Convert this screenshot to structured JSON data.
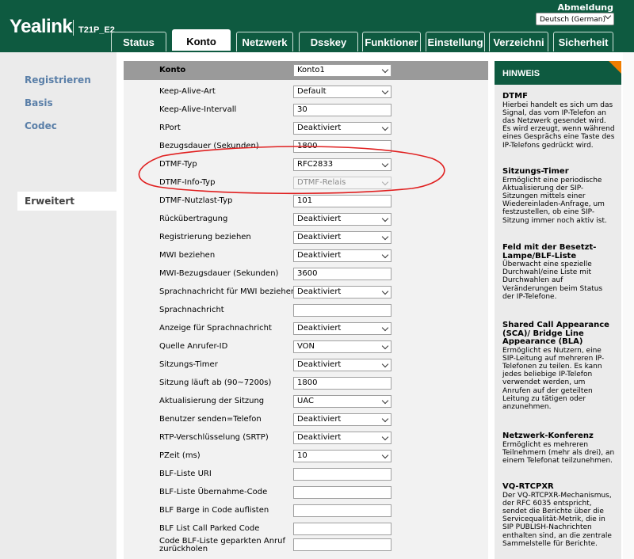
{
  "header": {
    "logo": "Yealink",
    "model": "T21P_E2",
    "logout": "Abmeldung",
    "language": "Deutsch (German)",
    "tabs": [
      "Status",
      "Konto",
      "Netzwerk",
      "Dsskey",
      "Funktioner",
      "Einstellung",
      "Verzeichni",
      "Sicherheit"
    ],
    "active_tab": "Konto"
  },
  "sidebar": {
    "items": [
      "Registrieren",
      "Basis",
      "Codec",
      "Erweitert"
    ],
    "active": "Erweitert"
  },
  "form": {
    "account_label": "Konto",
    "account_value": "Konto1",
    "rows": [
      {
        "label": "Keep-Alive-Art",
        "type": "select",
        "value": "Default"
      },
      {
        "label": "Keep-Alive-Intervall",
        "type": "input",
        "value": "30"
      },
      {
        "label": "RPort",
        "type": "select",
        "value": "Deaktiviert"
      },
      {
        "label": "Bezugsdauer (Sekunden)",
        "type": "input",
        "value": "1800"
      },
      {
        "label": "DTMF-Typ",
        "type": "select",
        "value": "RFC2833"
      },
      {
        "label": "DTMF-Info-Typ",
        "type": "select-disabled",
        "value": "DTMF-Relais"
      },
      {
        "label": "DTMF-Nutzlast-Typ",
        "type": "input",
        "value": "101"
      },
      {
        "label": "Rückübertragung",
        "type": "select",
        "value": "Deaktiviert"
      },
      {
        "label": "Registrierung beziehen",
        "type": "select",
        "value": "Deaktiviert"
      },
      {
        "label": "MWI beziehen",
        "type": "select",
        "value": "Deaktiviert"
      },
      {
        "label": "MWI-Bezugsdauer (Sekunden)",
        "type": "input",
        "value": "3600"
      },
      {
        "label": "Sprachnachricht für MWI beziehen",
        "type": "select",
        "value": "Deaktiviert"
      },
      {
        "label": "Sprachnachricht",
        "type": "input",
        "value": ""
      },
      {
        "label": "Anzeige für Sprachnachricht",
        "type": "select",
        "value": "Deaktiviert"
      },
      {
        "label": "Quelle Anrufer-ID",
        "type": "select",
        "value": "VON"
      },
      {
        "label": "Sitzungs-Timer",
        "type": "select",
        "value": "Deaktiviert"
      },
      {
        "label": "Sitzung läuft ab (90~7200s)",
        "type": "input",
        "value": "1800"
      },
      {
        "label": "Aktualisierung der Sitzung",
        "type": "select",
        "value": "UAC"
      },
      {
        "label": "Benutzer senden=Telefon",
        "type": "select",
        "value": "Deaktiviert"
      },
      {
        "label": "RTP-Verschlüsselung (SRTP)",
        "type": "select",
        "value": "Deaktiviert"
      },
      {
        "label": "PZeit (ms)",
        "type": "select",
        "value": "10"
      },
      {
        "label": "BLF-Liste URI",
        "type": "input",
        "value": ""
      },
      {
        "label": "BLF-Liste Übernahme-Code",
        "type": "input",
        "value": ""
      },
      {
        "label": "BLF Barge in Code auflisten",
        "type": "input",
        "value": ""
      },
      {
        "label": "BLF List Call Parked Code",
        "type": "input",
        "value": ""
      },
      {
        "label": "Code BLF-Liste geparkten Anruf zurückholen",
        "type": "input",
        "value": ""
      }
    ]
  },
  "hint": {
    "title": "HINWEIS",
    "sections": [
      {
        "title": "DTMF",
        "text": "Hierbei handelt es sich um das Signal, das vom IP-Telefon an das Netzwerk gesendet wird. Es wird erzeugt, wenn während eines Gesprächs eine Taste des IP-Telefons gedrückt wird."
      },
      {
        "title": "Sitzungs-Timer",
        "text": "Ermöglicht eine periodische Aktualisierung der SIP-Sitzungen mittels einer Wiedereinladen-Anfrage, um festzustellen, ob eine SIP-Sitzung immer noch aktiv ist."
      },
      {
        "title": "Feld mit der Besetzt-Lampe/BLF-Liste",
        "text": "Überwacht eine spezielle Durchwahl/eine Liste mit Durchwahlen auf Veränderungen beim Status der IP-Telefone."
      },
      {
        "title": "Shared Call Appearance (SCA)/ Bridge Line Appearance (BLA)",
        "text": "Ermöglicht es Nutzern, eine SIP-Leitung auf mehreren IP-Telefonen zu teilen. Es kann jedes beliebige IP-Telefon verwendet werden, um Anrufen auf der geteilten Leitung zu tätigen oder anzunehmen."
      },
      {
        "title": "Netzwerk-Konferenz",
        "text": "Ermöglicht es mehreren Teilnehmern (mehr als drei), an einem Telefonat teilzunehmen."
      },
      {
        "title": "VQ-RTCPXR",
        "text": "Der VQ-RTCPXR-Mechanismus, der RFC 6035 entspricht, sendet die Berichte über die Servicequalität-Metrik, die in SIP PUBLISH-Nachrichten enthalten sind, an die zentrale Sammelstelle für Berichte."
      }
    ]
  },
  "colors": {
    "brand": "#0e5a40",
    "accent": "#f07d00",
    "annotation": "#e02020",
    "sidebar_link": "#5a7fa8"
  }
}
